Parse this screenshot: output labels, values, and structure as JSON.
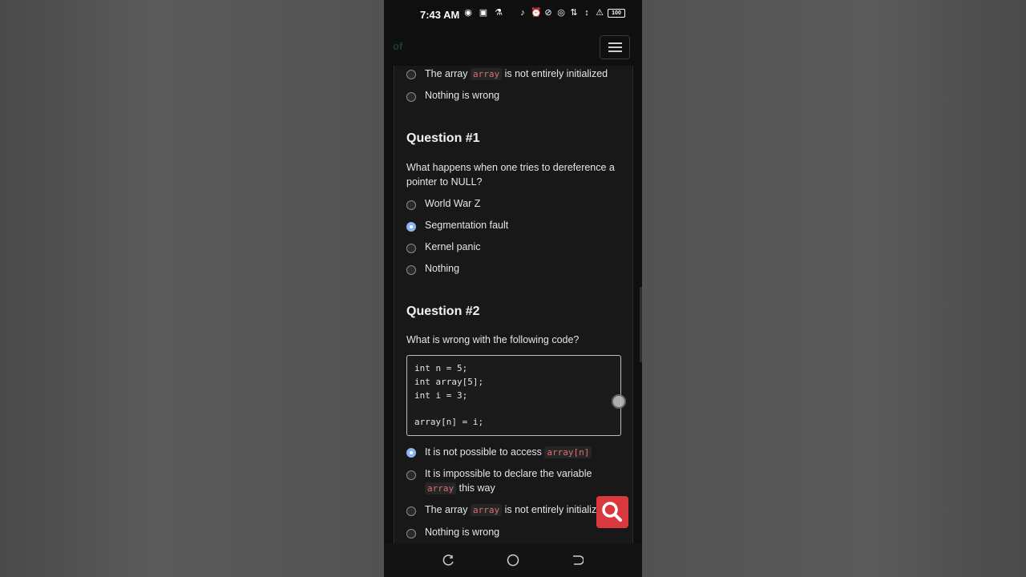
{
  "statusbar": {
    "time": "7:43 AM",
    "battery": "100",
    "icons": [
      "record-icon",
      "media-icon",
      "flask-icon",
      "bell-off-icon",
      "alarm-icon",
      "block-icon",
      "hotspot-icon",
      "4g-signal-icon",
      "data-speed-icon",
      "signal-icon",
      "alert-icon"
    ]
  },
  "navbar": {
    "brand": "of",
    "menu_icon": "hamburger-icon"
  },
  "prev_question": {
    "options": [
      {
        "before": "The array ",
        "code": "array",
        "after": " is not entirely initialized",
        "selected": false
      },
      {
        "before": "Nothing is wrong",
        "code": "",
        "after": "",
        "selected": false
      }
    ]
  },
  "question1": {
    "heading": "Question #1",
    "text": "What happens when one tries to dereference a pointer to NULL?",
    "options": [
      {
        "label": "World War Z",
        "selected": false
      },
      {
        "label": "Segmentation fault",
        "selected": true
      },
      {
        "label": "Kernel panic",
        "selected": false
      },
      {
        "label": "Nothing",
        "selected": false
      }
    ]
  },
  "question2": {
    "heading": "Question #2",
    "text": "What is wrong with the following code?",
    "code": [
      "int n = 5;",
      "int array[5];",
      "int i = 3;",
      "",
      "array[n] = i;"
    ],
    "options": [
      {
        "before": "It is not possible to access ",
        "code": "array[n]",
        "after": "",
        "selected": true
      },
      {
        "before": "It is impossible to declare the variable ",
        "code": "array",
        "after": " this way",
        "selected": false
      },
      {
        "before": "The array ",
        "code": "array",
        "after": " is not entirely initializ",
        "selected": false
      },
      {
        "before": "Nothing is wrong",
        "code": "",
        "after": "",
        "selected": false
      }
    ]
  },
  "fab": {
    "icon": "search-icon"
  },
  "system_nav": {
    "recent": "recent-apps-icon",
    "home": "home-icon",
    "back": "back-icon"
  },
  "colors": {
    "accent": "#8ab4f8",
    "fab": "#d9383f",
    "inline_code": "#e06c75"
  }
}
